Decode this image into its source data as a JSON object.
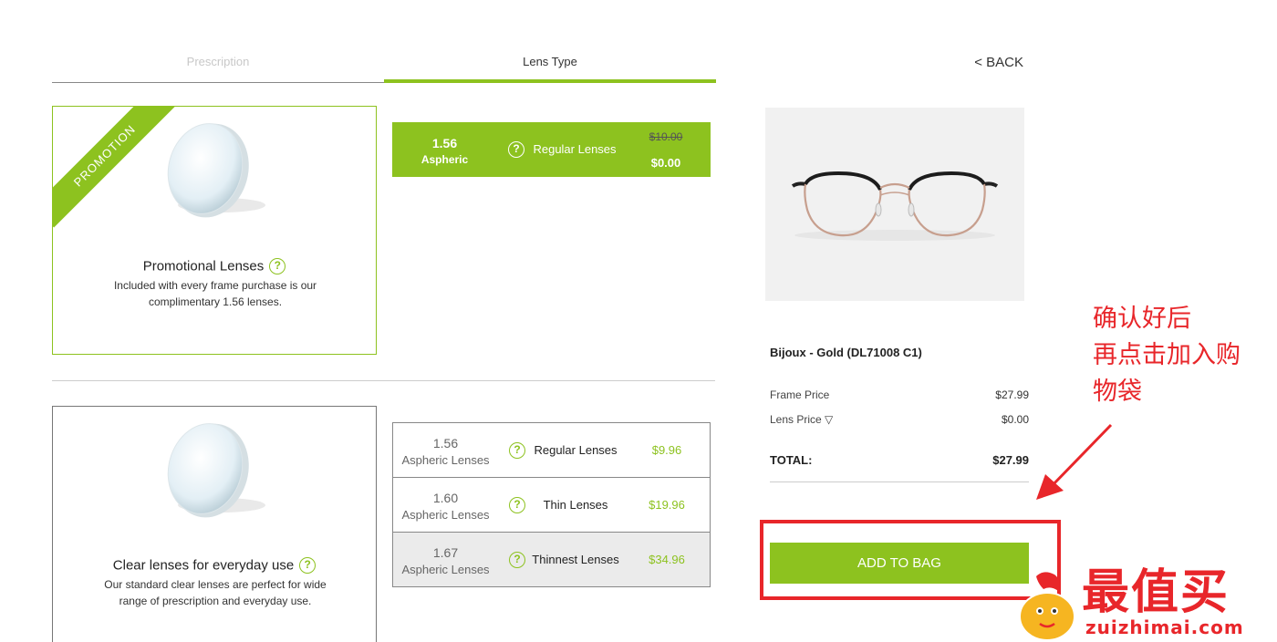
{
  "tabs": [
    {
      "label": "Prescription",
      "active": false
    },
    {
      "label": "Lens Type",
      "active": true
    }
  ],
  "back_label": "< BACK",
  "promo_card": {
    "ribbon": "PROMOTION",
    "title": "Promotional Lenses",
    "help_icon": "?",
    "description": "Included with every frame purchase is our complimentary 1.56 lenses."
  },
  "promo_options": [
    {
      "index": "1.56",
      "sub": "Aspheric",
      "name": "Regular Lenses",
      "old_price": "$10.00",
      "price": "$0.00",
      "selected": true
    }
  ],
  "clear_card": {
    "title": "Clear lenses for everyday use",
    "help_icon": "?",
    "description": "Our standard clear lenses are perfect for wide range of prescription and everyday use."
  },
  "clear_options": [
    {
      "index": "1.56",
      "sub": "Aspheric Lenses",
      "name": "Regular Lenses",
      "price": "$9.96"
    },
    {
      "index": "1.60",
      "sub": "Aspheric Lenses",
      "name": "Thin Lenses",
      "price": "$19.96"
    },
    {
      "index": "1.67",
      "sub": "Aspheric Lenses",
      "name": "Thinnest Lenses",
      "price": "$34.96",
      "highlighted": true
    }
  ],
  "summary": {
    "product_name": "Bijoux - Gold (DL71008 C1)",
    "frame_price_label": "Frame Price",
    "frame_price": "$27.99",
    "lens_price_label": "Lens Price ▽",
    "lens_price": "$0.00",
    "total_label": "TOTAL:",
    "total": "$27.99",
    "add_to_bag": "ADD TO BAG"
  },
  "annotation": {
    "line1": "确认好后",
    "line2": "再点击加入购",
    "line3": "物袋"
  },
  "watermark": {
    "title": "最值买",
    "url": "zuizhimai.com"
  },
  "colors": {
    "accent": "#8dc21f",
    "annotation": "#e8262a"
  },
  "icons": [
    "help-icon",
    "lens-icon",
    "glasses-image",
    "arrow-icon",
    "mascot-icon"
  ]
}
